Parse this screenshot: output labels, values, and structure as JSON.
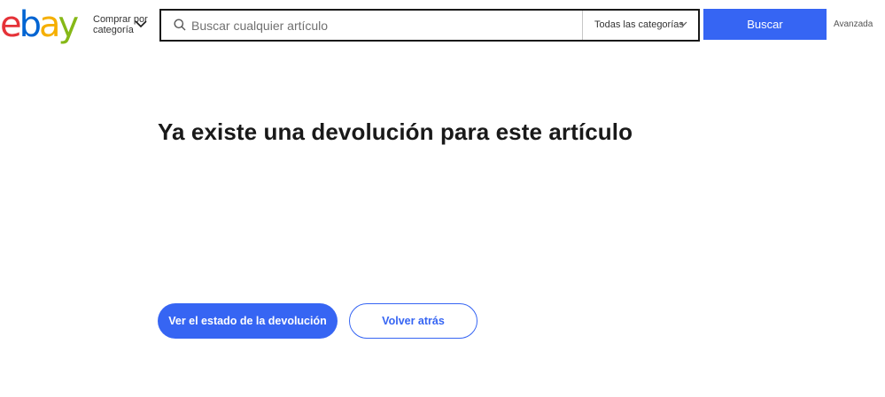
{
  "header": {
    "logo": {
      "letters": [
        "e",
        "b",
        "a",
        "y"
      ],
      "colors": [
        "#e53238",
        "#0064d2",
        "#f5af02",
        "#86b817"
      ]
    },
    "shop_by_label": "Comprar por categoría",
    "search": {
      "placeholder": "Buscar cualquier artículo",
      "value": ""
    },
    "category_select": "Todas las categorías",
    "search_button": "Buscar",
    "advanced_link": "Avanzada"
  },
  "main": {
    "title": "Ya existe una devolución para este artículo",
    "primary_button": "Ver el estado de la devolución",
    "secondary_button": "Volver atrás"
  },
  "colors": {
    "accent": "#3665f3",
    "text": "#191919"
  },
  "icons": {
    "search": "search-icon",
    "chevron": "chevron-down-icon"
  }
}
